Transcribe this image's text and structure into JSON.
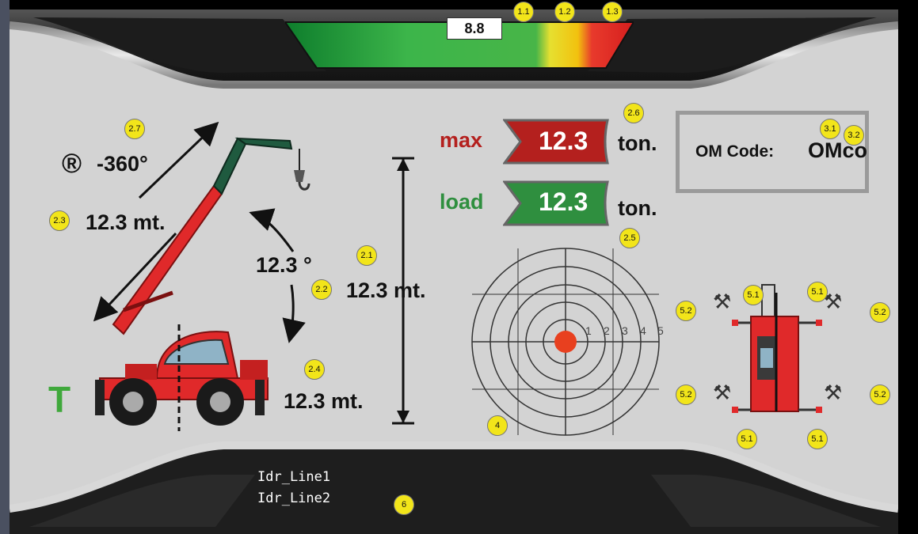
{
  "load_bar": {
    "value": "8.8",
    "fill": 0.58
  },
  "callouts": {
    "c11": "1.1",
    "c12": "1.2",
    "c13": "1.3",
    "c21": "2.1",
    "c22": "2.2",
    "c23": "2.3",
    "c24": "2.4",
    "c25": "2.5",
    "c26": "2.6",
    "c27": "2.7",
    "c31": "3.1",
    "c32": "3.2",
    "c4": "4",
    "c51a": "5.1",
    "c51b": "5.1",
    "c51c": "5.1",
    "c51d": "5.1",
    "c52a": "5.2",
    "c52b": "5.2",
    "c52c": "5.2",
    "c52d": "5.2",
    "c6": "6"
  },
  "rotation": {
    "symbol": "®",
    "value": "-360°"
  },
  "boom": {
    "length_value": "12.3 mt.",
    "angle_value": "12.3 °",
    "height_value": "12.3 mt.",
    "reach_value": "12.3 mt."
  },
  "load_info": {
    "max_label": "max",
    "max_value": "12.3",
    "max_unit": "ton.",
    "load_label": "load",
    "load_value": "12.3",
    "load_unit": "ton."
  },
  "om_code": {
    "label": "OM Code:",
    "value": "OMco"
  },
  "target": {
    "rings": [
      "1",
      "2",
      "3",
      "4",
      "5"
    ]
  },
  "idr": {
    "line1": "Idr_Line1",
    "line2": "Idr_Line2"
  },
  "colors": {
    "panel": "#d3d3d3",
    "max_red": "#b4201e",
    "load_green": "#2f8f3f",
    "callout_yellow": "#f2e51a",
    "machine_red": "#e0292a"
  }
}
